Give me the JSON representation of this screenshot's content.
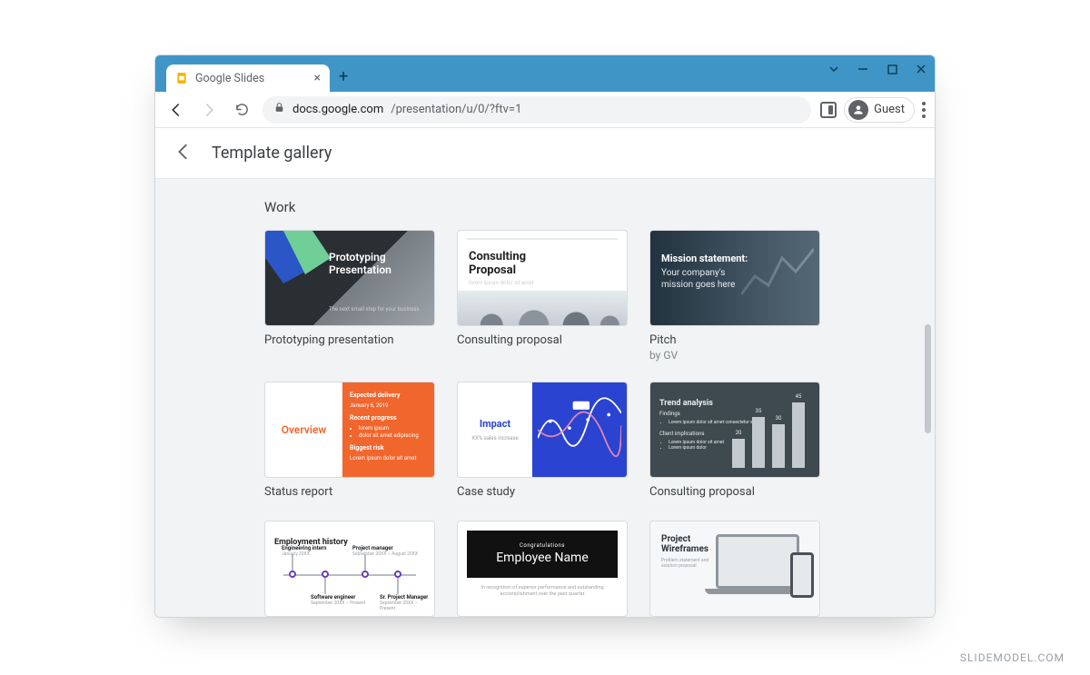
{
  "browser": {
    "tab_title": "Google Slides",
    "url_host": "docs.google.com",
    "url_path": "/presentation/u/0/?ftv=1",
    "guest_label": "Guest"
  },
  "page": {
    "title": "Template gallery",
    "section": "Work"
  },
  "templates": {
    "r1c1": {
      "title": "Prototyping presentation",
      "thumb_line1": "Prototyping",
      "thumb_line2": "Presentation"
    },
    "r1c2": {
      "title": "Consulting proposal",
      "thumb_line1": "Consulting",
      "thumb_line2": "Proposal"
    },
    "r1c3": {
      "title": "Pitch",
      "byline": "by GV",
      "thumb_line1": "Mission statement:",
      "thumb_line2": "Your company's",
      "thumb_line3": "mission goes here"
    },
    "r2c1": {
      "title": "Status report",
      "thumb_label": "Overview"
    },
    "r2c2": {
      "title": "Case study",
      "thumb_label": "Impact",
      "thumb_sub": "XX% sales increase"
    },
    "r2c3": {
      "title": "Consulting proposal",
      "thumb_title": "Trend analysis",
      "thumb_sub": "Findings"
    },
    "r3c1": {
      "thumb_title": "Employment history",
      "n1": "Engineering intern",
      "n2": "Project manager",
      "n3": "Software engineer",
      "n4": "Sr. Project Manager"
    },
    "r3c2": {
      "thumb_small": "Congratulations",
      "thumb_big": "Employee Name",
      "thumb_cap": "In recognition of superior performance and outstanding accomplishment over the past quarter"
    },
    "r3c3": {
      "thumb_line1": "Project",
      "thumb_line2": "Wireframes"
    }
  },
  "watermark": "SLIDEMODEL.COM"
}
